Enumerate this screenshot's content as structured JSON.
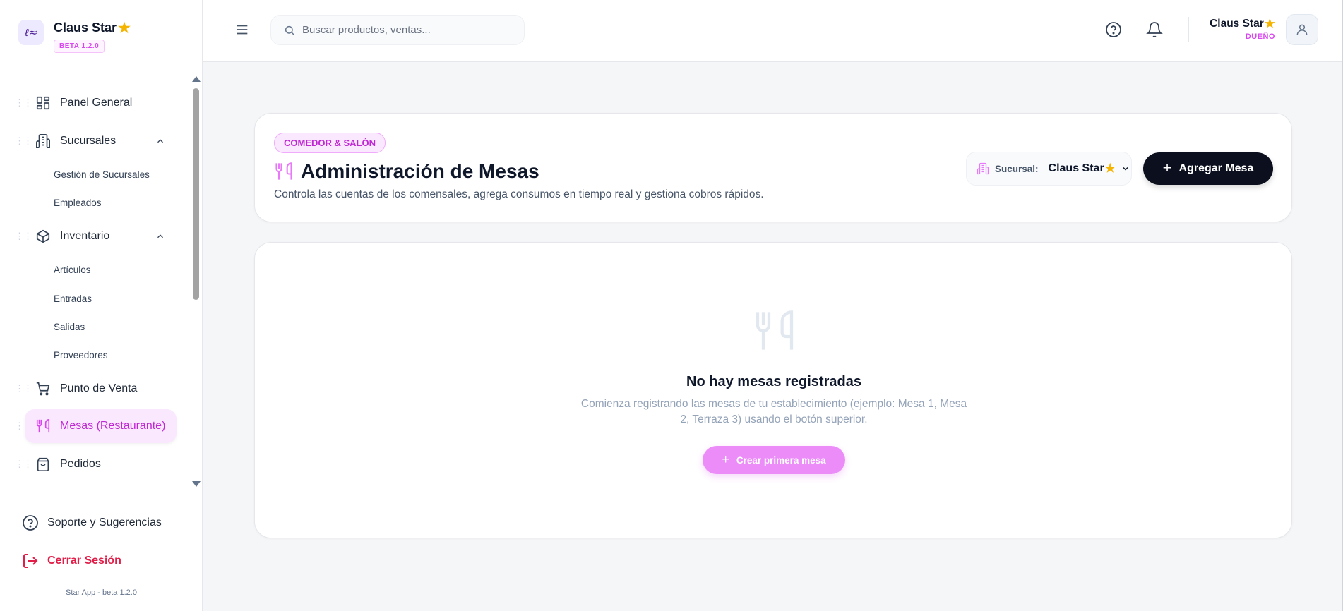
{
  "brand": {
    "name": "Claus Star",
    "badge": "BETA 1.2.0"
  },
  "sidebar": {
    "items": [
      {
        "label": "Panel General"
      },
      {
        "label": "Sucursales",
        "children": [
          "Gestión de Sucursales",
          "Empleados"
        ]
      },
      {
        "label": "Inventario",
        "children": [
          "Artículos",
          "Entradas",
          "Salidas",
          "Proveedores"
        ]
      },
      {
        "label": "Punto de Venta"
      },
      {
        "label": "Mesas (Restaurante)",
        "active": true
      },
      {
        "label": "Pedidos"
      }
    ],
    "support_label": "Soporte y Sugerencias",
    "logout_label": "Cerrar Sesión",
    "version": "Star App - beta 1.2.0"
  },
  "topbar": {
    "search_placeholder": "Buscar productos, ventas...",
    "user_name": "Claus Star",
    "user_role": "DUEÑO"
  },
  "header": {
    "tag": "COMEDOR & SALÓN",
    "title": "Administración de Mesas",
    "description": "Controla las cuentas de los comensales, agrega consumos en tiempo real y gestiona cobros rápidos.",
    "branch_label": "Sucursal:",
    "branch_value": "Claus Star",
    "add_button": "Agregar Mesa"
  },
  "empty_state": {
    "title": "No hay mesas registradas",
    "text": "Comienza registrando las mesas de tu establecimiento (ejemplo: Mesa 1, Mesa 2, Terraza 3) usando el botón superior.",
    "button": "Crear primera mesa"
  },
  "colors": {
    "accent": "#d946ef",
    "dark_button": "#0b0f1e",
    "danger": "#e11d48",
    "star": "#f5b400"
  },
  "icons": [
    "dashboard-icon",
    "building-icon",
    "box-icon",
    "cart-icon",
    "utensils-icon",
    "bag-icon",
    "help-icon",
    "bell-icon",
    "user-icon",
    "logout-icon",
    "search-icon",
    "menu-icon"
  ]
}
